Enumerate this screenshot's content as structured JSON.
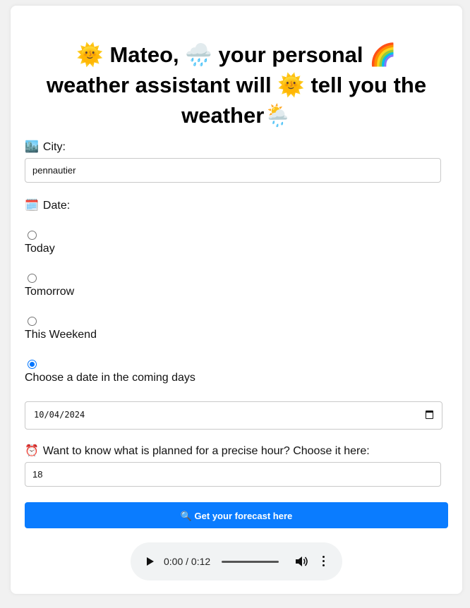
{
  "header": {
    "sun_emoji": "🌞",
    "name": "Mateo,",
    "rain_emoji": "🌧️",
    "part1": "your personal",
    "rainbow_emoji": "🌈",
    "part2": "weather assistant will",
    "part3": "tell you the weather",
    "end_emoji": "🌦️"
  },
  "city": {
    "icon": "🏙️",
    "label": "City:",
    "value": "pennautier"
  },
  "date": {
    "icon": "🗓️",
    "label": "Date:",
    "options": [
      {
        "label": "Today",
        "checked": false
      },
      {
        "label": "Tomorrow",
        "checked": false
      },
      {
        "label": "This Weekend",
        "checked": false
      },
      {
        "label": "Choose a date in the coming days",
        "checked": true
      }
    ],
    "selected_date": "10/04/2024"
  },
  "hour": {
    "icon": "⏰",
    "label": "Want to know what is planned for a precise hour? Choose it here:",
    "value": "18"
  },
  "forecast_button": {
    "icon": "🔍",
    "label": "Get your forecast here",
    "color": "#0a7cff"
  },
  "audio": {
    "time": "0:00 / 0:12",
    "progress": 0
  }
}
